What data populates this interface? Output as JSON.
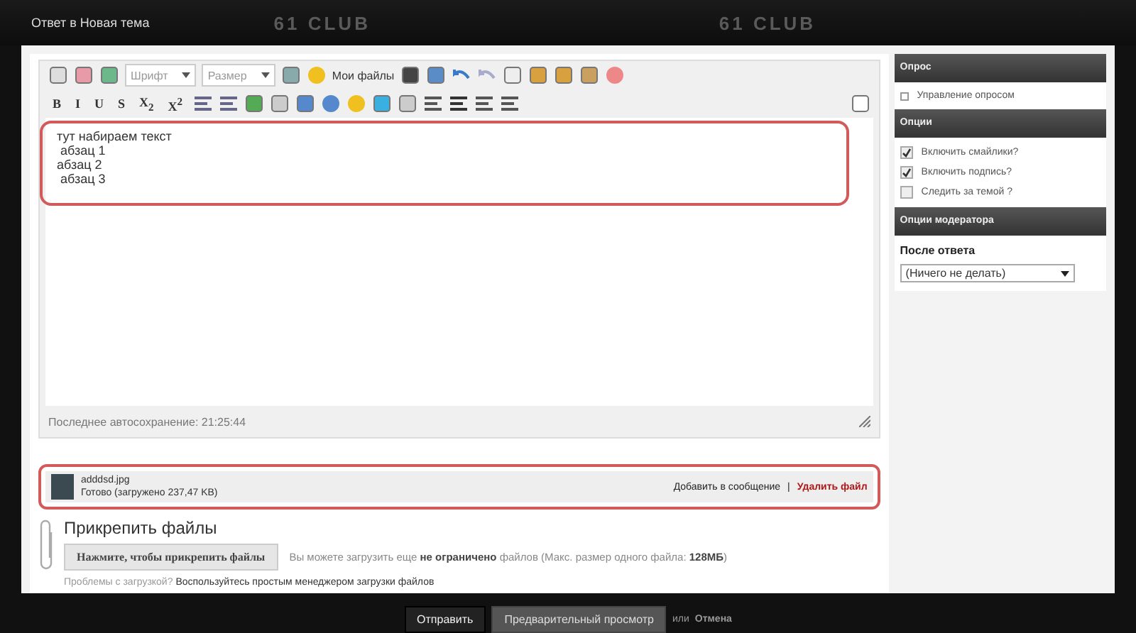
{
  "header": {
    "title": "Ответ в Новая тема",
    "logos": [
      "61 CLUB",
      "61 CLUB"
    ]
  },
  "editor": {
    "font_select": "Шрифт",
    "size_select": "Размер",
    "my_files": "Мои файлы",
    "format_buttons": [
      "B",
      "I",
      "U",
      "S",
      "X$_{2}$",
      "X$^{2}$"
    ],
    "lines": [
      "тут набираем текст",
      " абзац 1",
      "абзац 2",
      " абзац 3"
    ],
    "autosave": "Последнее автосохранение: 21:25:44"
  },
  "attachment": {
    "name": "adddsd.jpg",
    "status": "Готово (загружено 237,47 KB)",
    "insert_link": "Добавить в сообщение",
    "separator": "|",
    "delete_link": "Удалить файл"
  },
  "attach": {
    "title": "Прикрепить файлы",
    "button": "Нажмите, чтобы прикрепить файлы",
    "info": "Вы можете загрузить еще **не ограничено** файлов (Макс. размер одного файла: **128МБ**)",
    "problems": "Проблемы с загрузкой?",
    "simple_link": "Воспользуйтесь простым менеджером загрузки файлов"
  },
  "sidebar": {
    "sections": [
      {
        "title": "Опрос",
        "kind": "links",
        "items": [
          {
            "label": "Управление опросом"
          }
        ]
      },
      {
        "title": "Опции",
        "kind": "checks",
        "items": [
          {
            "label": "Включить смайлики?",
            "checked": true
          },
          {
            "label": "Включить подпись?",
            "checked": true
          },
          {
            "label": "Следить за темой ?",
            "checked": false
          }
        ]
      },
      {
        "title": "Опции модератора",
        "kind": "select",
        "label": "После ответа",
        "value": "(Ничего не делать)"
      }
    ]
  },
  "footer": {
    "submit": "Отправить",
    "preview": "Предварительный просмотр",
    "or": "или",
    "cancel": "Отмена"
  }
}
